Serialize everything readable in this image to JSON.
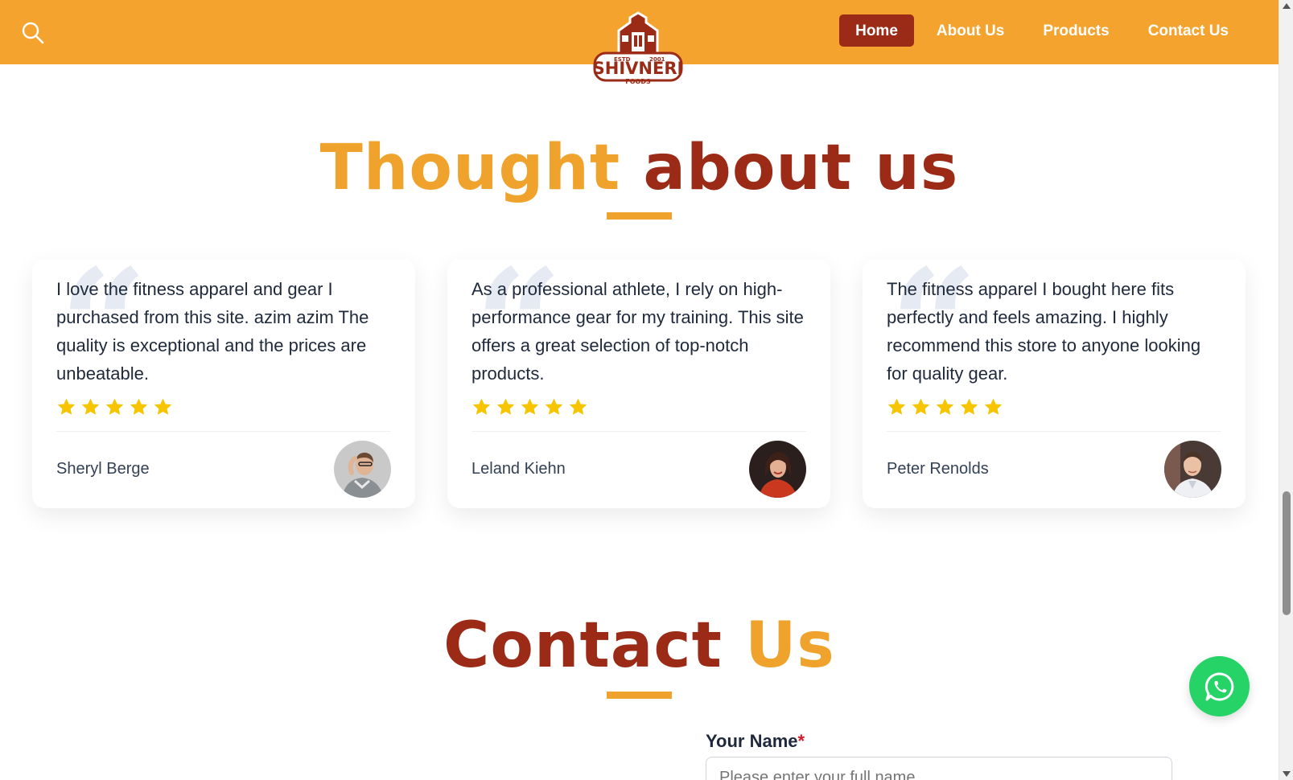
{
  "header": {
    "logo": {
      "brand": "SHIVNERI",
      "sub": "FOODS",
      "estd": "ESTD",
      "year": "2001"
    },
    "nav": [
      {
        "label": "Home",
        "active": true
      },
      {
        "label": "About Us",
        "active": false
      },
      {
        "label": "Products",
        "active": false
      },
      {
        "label": "Contact Us",
        "active": false
      }
    ]
  },
  "testimonials": {
    "title_part1": "Thought",
    "title_part2": "about us",
    "items": [
      {
        "text": "I love the fitness apparel and gear I purchased from this site. azim azim The quality is exceptional and the prices are unbeatable.",
        "rating": 5,
        "name": "Sheryl Berge",
        "avatar": "avatar-man-gray-shirt"
      },
      {
        "text": "As a professional athlete, I rely on high-performance gear for my training. This site offers a great selection of top-notch products.",
        "rating": 5,
        "name": "Leland Kiehn",
        "avatar": "avatar-woman-red-dress"
      },
      {
        "text": "The fitness apparel I bought here fits perfectly and feels amazing. I highly recommend this store to anyone looking for quality gear.",
        "rating": 5,
        "name": "Peter Renolds",
        "avatar": "avatar-man-white-shirt"
      }
    ]
  },
  "contact": {
    "title_part1": "Contact",
    "title_part2": "Us",
    "name_label": "Your Name",
    "required_mark": "*",
    "name_placeholder": "Please enter your full name"
  },
  "colors": {
    "header": "#f4a42e",
    "accent_brown": "#9b2a16",
    "accent_orange": "#f0a32c",
    "star": "#f6c500",
    "whatsapp": "#25d366"
  },
  "icons": {
    "search": "search-icon",
    "star": "star-icon",
    "whatsapp": "whatsapp-icon"
  }
}
